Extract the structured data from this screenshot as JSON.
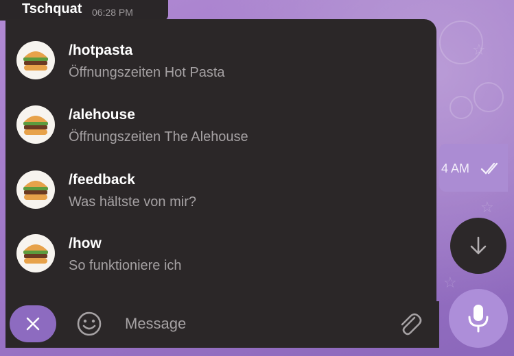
{
  "chat": {
    "sender_name": "Tschquat",
    "sender_time": "06:28 PM",
    "bubble_time": "4 AM"
  },
  "commands": [
    {
      "name": "/hotpasta",
      "description": "Öffnungszeiten Hot Pasta",
      "icon": "hamburger-icon"
    },
    {
      "name": "/alehouse",
      "description": "Öffnungszeiten The Alehouse",
      "icon": "hamburger-icon"
    },
    {
      "name": "/feedback",
      "description": "Was hältste von mir?",
      "icon": "hamburger-icon"
    },
    {
      "name": "/how",
      "description": "So funktioniere ich",
      "icon": "hamburger-icon"
    }
  ],
  "composer": {
    "placeholder": "Message",
    "close_icon": "close-icon",
    "emoji_icon": "emoji-icon",
    "attach_icon": "paperclip-icon",
    "mic_icon": "microphone-icon",
    "scroll_icon": "arrow-down-icon"
  },
  "colors": {
    "panel": "#2b2728",
    "accent": "#8d6bc0",
    "wallpaper": "#a07bc9",
    "text_primary": "#ffffff",
    "text_secondary": "#a5a1a3"
  }
}
